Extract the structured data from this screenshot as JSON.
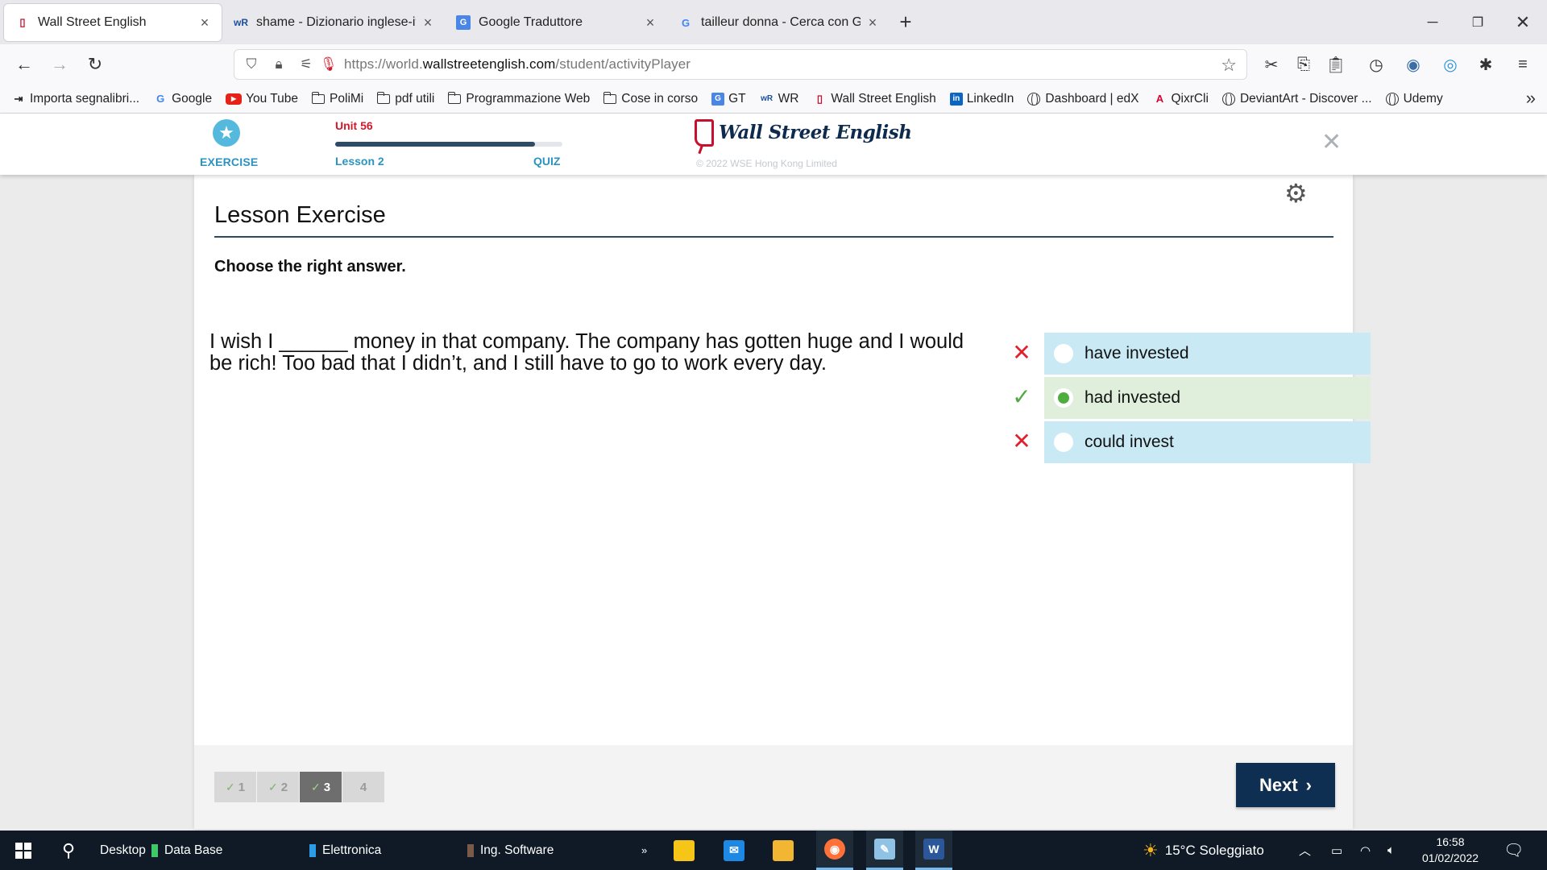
{
  "browser": {
    "tabs": [
      {
        "title": "Wall Street English",
        "icon": "wse-logo-icon"
      },
      {
        "title": "shame - Dizionario inglese-italia",
        "icon": "wr-icon"
      },
      {
        "title": "Google Traduttore",
        "icon": "google-translate-icon"
      },
      {
        "title": "tailleur donna - Cerca con Goog",
        "icon": "google-icon"
      }
    ],
    "url_prefix": "https://world.",
    "url_domain": "wallstreetenglish.com",
    "url_path": "/student/activityPlayer",
    "bookmarks": [
      {
        "label": "Importa segnalibri...",
        "icon": "import-icon"
      },
      {
        "label": "Google",
        "icon": "google-icon"
      },
      {
        "label": "You Tube",
        "icon": "youtube-icon"
      },
      {
        "label": "PoliMi",
        "icon": "folder-icon"
      },
      {
        "label": "pdf utili",
        "icon": "folder-icon"
      },
      {
        "label": "Programmazione Web",
        "icon": "folder-icon"
      },
      {
        "label": "Cose in corso",
        "icon": "folder-icon"
      },
      {
        "label": "GT",
        "icon": "google-translate-icon"
      },
      {
        "label": "WR",
        "icon": "wr-icon"
      },
      {
        "label": "Wall Street English",
        "icon": "wse-logo-icon"
      },
      {
        "label": "LinkedIn",
        "icon": "linkedin-icon"
      },
      {
        "label": "Dashboard | edX",
        "icon": "globe-icon"
      },
      {
        "label": "QixrCli",
        "icon": "angular-icon"
      },
      {
        "label": "DeviantArt - Discover ...",
        "icon": "globe-icon"
      },
      {
        "label": "Udemy",
        "icon": "globe-icon"
      }
    ]
  },
  "header": {
    "exercise_label": "EXERCISE",
    "unit_label": "Unit 56",
    "lesson_label": "Lesson 2",
    "quiz_label": "QUIZ",
    "progress": 0.88,
    "logo_text": "Wall Street English",
    "copyright": "© 2022 WSE Hong Kong Limited"
  },
  "exercise": {
    "title": "Lesson Exercise",
    "instruction": "Choose the right answer.",
    "question": "I wish I ______ money in that company. The company has gotten huge and I would be rich! Too bad that I didn’t, and I still have to go to work every day.",
    "options": [
      {
        "label": "have invested",
        "result": "wrong",
        "selected": false
      },
      {
        "label": "had invested",
        "result": "correct",
        "selected": true
      },
      {
        "label": "could invest",
        "result": "wrong",
        "selected": false
      }
    ]
  },
  "footer": {
    "steps": [
      {
        "number": "1",
        "done": true,
        "current": false
      },
      {
        "number": "2",
        "done": true,
        "current": false
      },
      {
        "number": "3",
        "done": true,
        "current": true
      },
      {
        "number": "4",
        "done": false,
        "current": false
      }
    ],
    "next_label": "Next"
  },
  "taskbar": {
    "desktop_label": "Desktop",
    "pinned_folders": [
      "Data Base",
      "Elettronica",
      "Ing. Software"
    ],
    "weather": "15°C Soleggiato",
    "time": "16:58",
    "date": "01/02/2022"
  },
  "colors": {
    "brand_navy": "#0e2f52",
    "accent_blue": "#2b93bf",
    "brand_red": "#d0192b",
    "option_blue": "#c9e9f5",
    "option_green": "#dfefdb"
  }
}
